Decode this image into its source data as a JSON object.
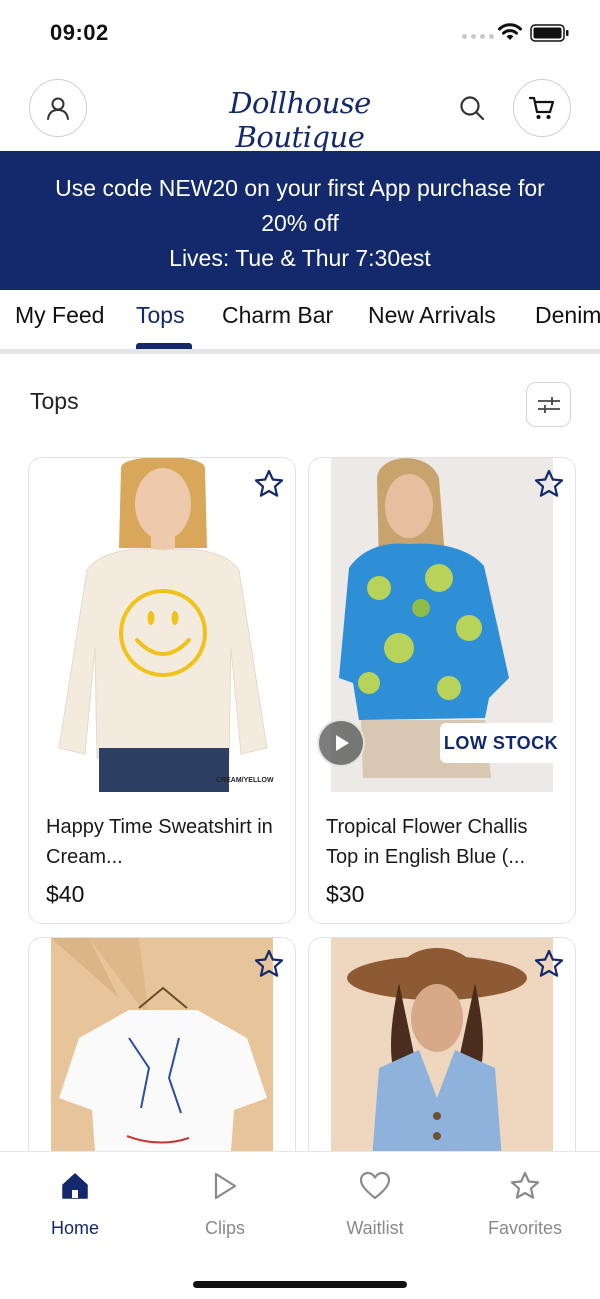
{
  "status_bar": {
    "time": "09:02"
  },
  "header": {
    "logo_text": "Dollhouse Boutique"
  },
  "promo": {
    "line1": "Use code NEW20 on your first App purchase for",
    "line2": "20% off",
    "line3": "Lives: Tue & Thur 7:30est"
  },
  "tabs": [
    {
      "label": "My Feed"
    },
    {
      "label": "Tops"
    },
    {
      "label": "Charm Bar"
    },
    {
      "label": "New Arrivals"
    },
    {
      "label": "Denim"
    }
  ],
  "active_tab": "Tops",
  "section": {
    "title": "Tops"
  },
  "products": [
    {
      "name": "Happy Time Sweatshirt in Cream...",
      "price": "$40",
      "image_caption": "CREAM/YELLOW"
    },
    {
      "name": "Tropical Flower Challis Top in English Blue (...",
      "price": "$30",
      "badge": "LOW STOCK",
      "has_video": true
    },
    {
      "name": "",
      "price": ""
    },
    {
      "name": "",
      "price": ""
    }
  ],
  "bottom_nav": [
    {
      "label": "Home",
      "icon": "home-icon",
      "active": true
    },
    {
      "label": "Clips",
      "icon": "play-icon"
    },
    {
      "label": "Waitlist",
      "icon": "heart-icon"
    },
    {
      "label": "Favorites",
      "icon": "star-icon"
    }
  ],
  "colors": {
    "brand_navy": "#13296b",
    "promo_bg": "#13296b",
    "inactive_gray": "#8a8a8a"
  }
}
